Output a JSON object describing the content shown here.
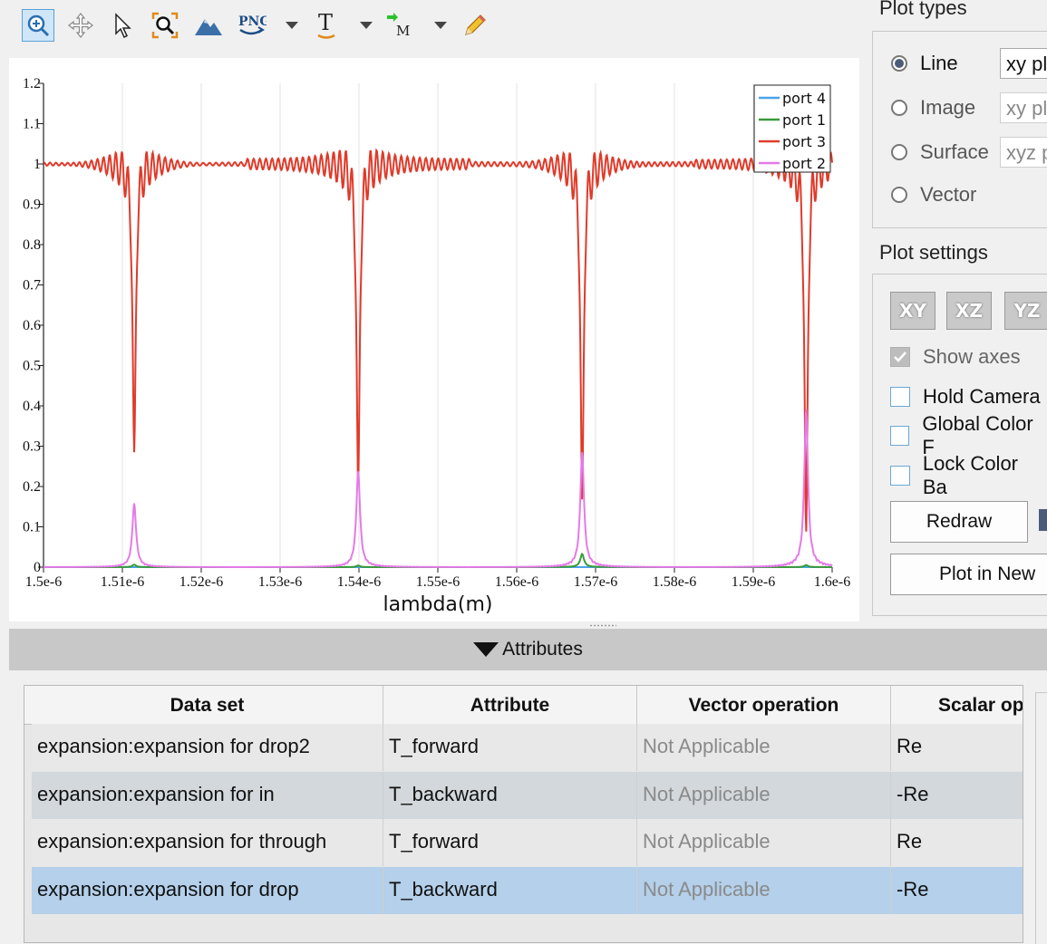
{
  "toolbar": {
    "items": [
      {
        "icon": "zoom-in-icon",
        "active": true
      },
      {
        "icon": "pan-icon"
      },
      {
        "icon": "pointer-icon"
      },
      {
        "icon": "zoom-fit-icon"
      },
      {
        "icon": "mountain-icon"
      },
      {
        "icon": "png-export-icon",
        "text": "PNG",
        "dropdown": true
      },
      {
        "icon": "text-tool-icon",
        "text": "T",
        "dropdown": true
      },
      {
        "icon": "marker-icon",
        "text": "M",
        "dropdown": true
      },
      {
        "icon": "pencil-icon"
      }
    ]
  },
  "chart_data": {
    "type": "line",
    "xlabel": "lambda(m)",
    "ylabel": "",
    "xlim": [
      1.5e-06,
      1.6e-06
    ],
    "ylim": [
      0,
      1.2
    ],
    "x_ticks": [
      "1.5e-6",
      "1.51e-6",
      "1.52e-6",
      "1.53e-6",
      "1.54e-6",
      "1.55e-6",
      "1.56e-6",
      "1.57e-6",
      "1.58e-6",
      "1.59e-6",
      "1.6e-6"
    ],
    "y_ticks": [
      "0",
      "0.1",
      "0.2",
      "0.3",
      "0.4",
      "0.5",
      "0.6",
      "0.7",
      "0.8",
      "0.9",
      "1",
      "1.1",
      "1.2"
    ],
    "resonances": [
      1.5115e-06,
      1.5399e-06,
      1.5683e-06,
      1.5967e-06
    ],
    "legend_position": "top-right",
    "grid": true,
    "series": [
      {
        "name": "port 4",
        "color": "#4aa3e8",
        "baseline": 0.0,
        "peaks": [
          0.0,
          0.0,
          0.0,
          0.0
        ]
      },
      {
        "name": "port 1",
        "color": "#3a9a3a",
        "baseline": 0.0,
        "peaks": [
          0.006,
          0.004,
          0.032,
          0.005
        ]
      },
      {
        "name": "port 3",
        "color": "#e03a2a",
        "baseline": 1.0,
        "dips": [
          0.285,
          0.2,
          0.165,
          0.085
        ],
        "ripple": 0.1
      },
      {
        "name": "port 2",
        "color": "#e47ae8",
        "baseline": 0.0,
        "peaks": [
          0.155,
          0.235,
          0.28,
          0.385
        ]
      }
    ]
  },
  "right_panel": {
    "plot_types_title": "Plot types",
    "plot_types": [
      {
        "label": "Line",
        "selected": true,
        "combo": "xy plot"
      },
      {
        "label": "Image",
        "selected": false,
        "combo": "xy plot"
      },
      {
        "label": "Surface",
        "selected": false,
        "combo": "xyz plot"
      },
      {
        "label": "Vector",
        "selected": false
      }
    ],
    "plot_settings_title": "Plot settings",
    "view_buttons": [
      "XY",
      "XZ",
      "YZ"
    ],
    "checkboxes": [
      {
        "label": "Show axes",
        "checked": true,
        "disabled": true
      },
      {
        "label": "Hold Camera",
        "checked": false
      },
      {
        "label": "Global Color F",
        "checked": false
      },
      {
        "label": "Lock Color Ba",
        "checked": false
      }
    ],
    "redraw_label": "Redraw",
    "plot_new_label": "Plot in New"
  },
  "attributes": {
    "header": "Attributes",
    "columns": [
      "Data set",
      "Attribute",
      "Vector operation",
      "Scalar op"
    ],
    "rows": [
      {
        "dataset": "expansion:expansion for drop2",
        "attribute": "T_forward",
        "vector": "Not Applicable",
        "scalar": "Re",
        "bg": "#e8e8e8"
      },
      {
        "dataset": "expansion:expansion for in",
        "attribute": "T_backward",
        "vector": "Not Applicable",
        "scalar": "-Re",
        "bg": "#d2d8dc"
      },
      {
        "dataset": "expansion:expansion for through",
        "attribute": "T_forward",
        "vector": "Not Applicable",
        "scalar": "Re",
        "bg": "#e8e8e8"
      },
      {
        "dataset": "expansion:expansion for drop",
        "attribute": "T_backward",
        "vector": "Not Applicable",
        "scalar": "-Re",
        "bg": "#b4d0ea"
      }
    ]
  }
}
